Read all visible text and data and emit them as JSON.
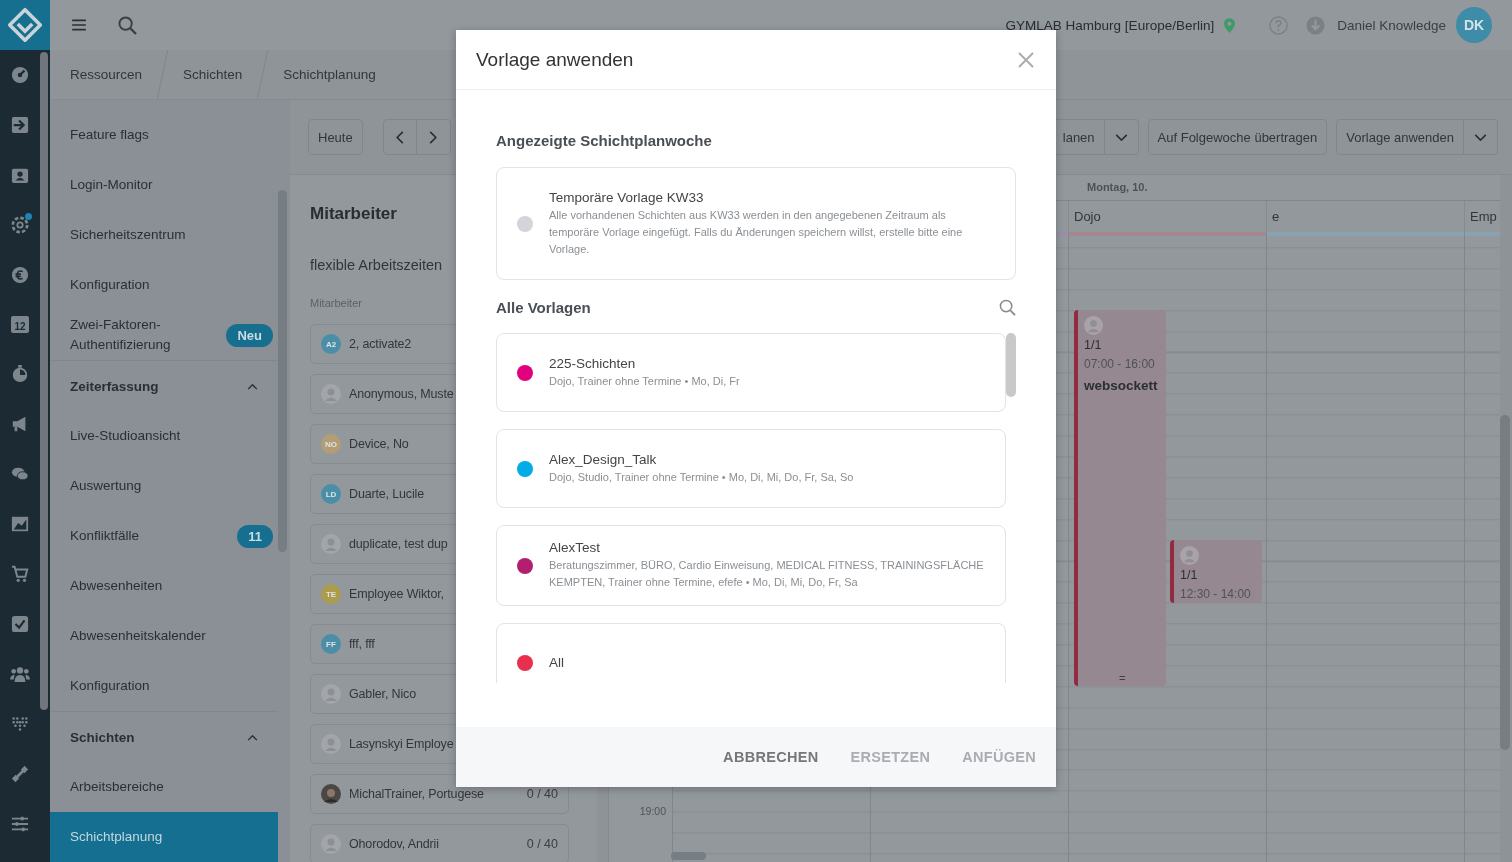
{
  "topbar": {
    "location": "GYMLAB Hamburg [Europe/Berlin]",
    "user": "Daniel Knowledge",
    "user_initials": "DK"
  },
  "rail": {
    "calendar_day": "12",
    "settings_notification": true
  },
  "breadcrumbs": [
    "Ressourcen",
    "Schichten",
    "Schichtplanung"
  ],
  "sidebar": {
    "items": [
      {
        "label": "Feature flags",
        "selected": false
      },
      {
        "label": "Login-Monitor",
        "selected": false
      },
      {
        "label": "Sicherheitszentrum",
        "selected": false
      },
      {
        "label": "Konfiguration",
        "selected": false
      },
      {
        "label": "Zwei-Faktoren-Authentifizierung",
        "selected": false,
        "badge": "Neu"
      }
    ],
    "sections": [
      {
        "title": "Zeiterfassung",
        "expanded": true,
        "items": [
          {
            "label": "Live-Studioansicht",
            "selected": false
          },
          {
            "label": "Auswertung",
            "selected": false
          },
          {
            "label": "Konfliktfälle",
            "selected": false,
            "badge": "11"
          },
          {
            "label": "Abwesenheiten",
            "selected": false
          },
          {
            "label": "Abwesenheitskalender",
            "selected": false
          },
          {
            "label": "Konfiguration",
            "selected": false
          }
        ]
      },
      {
        "title": "Schichten",
        "expanded": true,
        "items": [
          {
            "label": "Arbeitsbereiche",
            "selected": false
          },
          {
            "label": "Schichtplanung",
            "selected": true
          }
        ]
      }
    ]
  },
  "toolbar": {
    "today": "Heute",
    "right_buttons": [
      {
        "label": "lanen",
        "dropdown": true
      },
      {
        "label": "Auf Folgewoche übertragen",
        "dropdown": false
      },
      {
        "label": "Vorlage anwenden",
        "dropdown": true
      }
    ]
  },
  "employees": {
    "title": "Mitarbeiter",
    "filter": "flexible Arbeitszeiten",
    "list_label": "Mitarbeiter",
    "rows": [
      {
        "name": "2, activate2",
        "avatar": {
          "kind": "initials",
          "initials": "A2",
          "color": "#4a8ea8"
        }
      },
      {
        "name": "Anonymous, Muste",
        "avatar": {
          "kind": "silhouette"
        }
      },
      {
        "name": "Device, No",
        "avatar": {
          "kind": "initials",
          "initials": "NO",
          "color": "#b39d74"
        }
      },
      {
        "name": "Duarte, Lucile",
        "avatar": {
          "kind": "initials",
          "initials": "LD",
          "color": "#4a8ea8"
        }
      },
      {
        "name": "duplicate, test dup",
        "avatar": {
          "kind": "silhouette"
        }
      },
      {
        "name": "Employee Wiktor,",
        "avatar": {
          "kind": "initials",
          "initials": "TE",
          "color": "#ab9c4e"
        }
      },
      {
        "name": "fff, fff",
        "avatar": {
          "kind": "initials",
          "initials": "FF",
          "color": "#4a8ea8"
        }
      },
      {
        "name": "Gabler, Nico",
        "avatar": {
          "kind": "silhouette"
        }
      },
      {
        "name": "Lasynskyi Employe",
        "avatar": {
          "kind": "silhouette"
        }
      },
      {
        "name": "MichalTrainer, Portugese",
        "hours": "0 / 40"
      },
      {
        "name": "Ohorodov, Andrii",
        "avatar": {
          "kind": "silhouette"
        },
        "hours": "0 / 40"
      }
    ]
  },
  "calendar": {
    "day": "Montag, 10.",
    "time_labels": [
      "19:00"
    ],
    "columns": [
      {
        "color": "#9690a8"
      },
      {
        "label": "Dojo",
        "color": "#a4878f"
      },
      {
        "label": "e",
        "color": "#87a3b1"
      },
      {
        "label": "Emp",
        "color": "#87a3b1"
      }
    ],
    "events": [
      {
        "count": "1/1",
        "time": "07:00 - 16:00",
        "title": "websockett",
        "handle": "="
      },
      {
        "count": "1/1",
        "time": "12:30 - 14:00"
      }
    ]
  },
  "modal": {
    "title": "Vorlage anwenden",
    "current_heading": "Angezeigte Schichtplanwoche",
    "current": {
      "title": "Temporäre Vorlage KW33",
      "description": "Alle vorhandenen Schichten aus KW33 werden in den angegebenen Zeitraum als temporäre Vorlage eingefügt. Falls du Änderungen speichern willst, erstelle bitte eine Vorlage.",
      "color": "#d3d5da"
    },
    "all_heading": "Alle Vorlagen",
    "templates": [
      {
        "name": "225-Schichten",
        "details": "Dojo, Trainer ohne Termine • Mo, Di, Fr",
        "color": "#e2007e"
      },
      {
        "name": "Alex_Design_Talk",
        "details": "Dojo, Studio, Trainer ohne Termine • Mo, Di, Mi, Do, Fr, Sa, So",
        "color": "#00ade6"
      },
      {
        "name": "AlexTest",
        "details": "Beratungszimmer, BÜRO, Cardio Einweisung, MEDICAL FITNESS, TRAININGSFLÄCHE KEMPTEN, Trainer ohne Termine, efefe • Mo, Di, Mi, Do, Fr, Sa",
        "color": "#b0206e"
      },
      {
        "name": "All",
        "color": "#e8304e"
      }
    ],
    "buttons": [
      {
        "label": "ABBRECHEN",
        "disabled": false
      },
      {
        "label": "ERSETZEN",
        "disabled": true
      },
      {
        "label": "ANFÜGEN",
        "disabled": true
      }
    ]
  }
}
